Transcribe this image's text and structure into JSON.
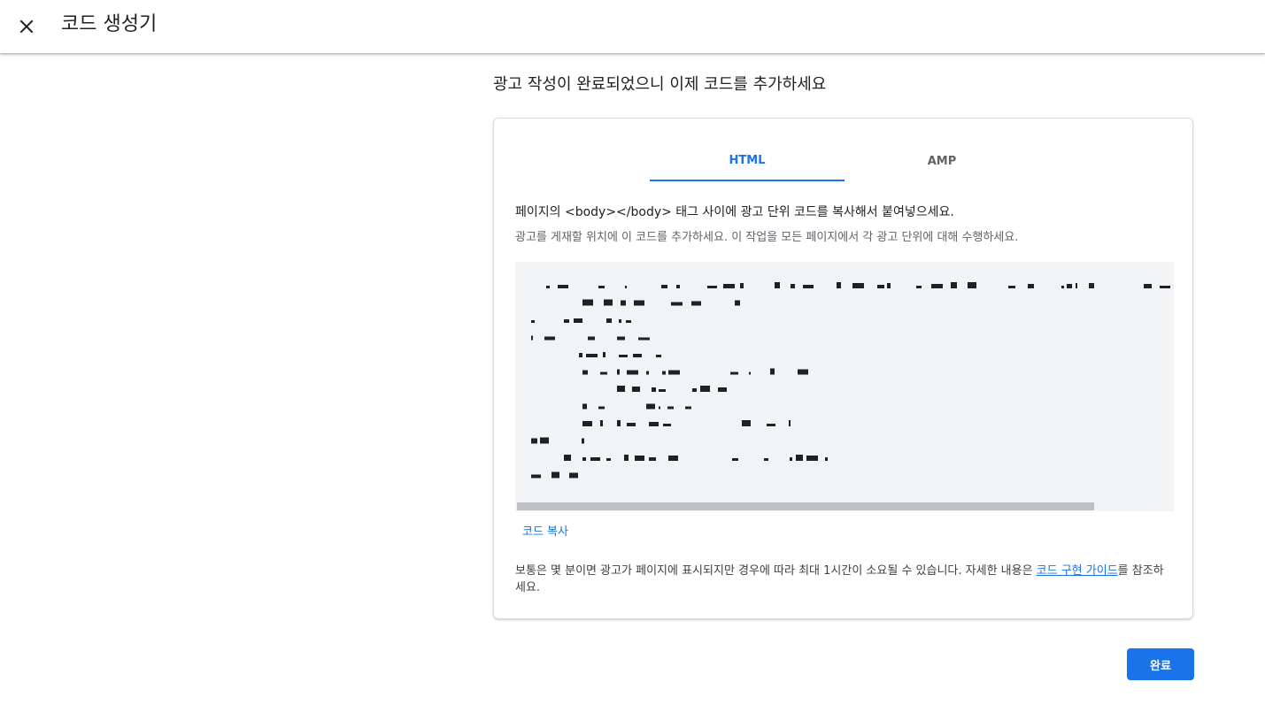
{
  "header": {
    "title": "코드 생성기",
    "close_icon": "close-icon"
  },
  "main": {
    "heading": "광고 작성이 완료되었으니 이제 코드를 추가하세요"
  },
  "tabs": [
    {
      "label": "HTML",
      "active": true
    },
    {
      "label": "AMP",
      "active": false
    }
  ],
  "instructions": {
    "title": "페이지의 <body></body> 태그 사이에 광고 단위 코드를 복사해서 붙여넣으세요.",
    "subtitle": "광고를 게재할 위치에 이 코드를 추가하세요. 이 작업을 모든 페이지에서 각 광고 단위에 대해 수행하세요."
  },
  "code": {
    "state": "obscured"
  },
  "copy_link": "코드 복사",
  "footnote": {
    "text_before": "보통은 몇 분이면 광고가 페이지에 표시되지만 경우에 따라 최대 1시간이 소요될 수 있습니다. 자세한 내용은 ",
    "link": "코드 구현 가이드",
    "text_after": "를 참조하세요."
  },
  "done_button": "완료",
  "colors": {
    "accent": "#1a73e8",
    "code_background": "#f1f3f4",
    "code_noise": "#202124"
  }
}
